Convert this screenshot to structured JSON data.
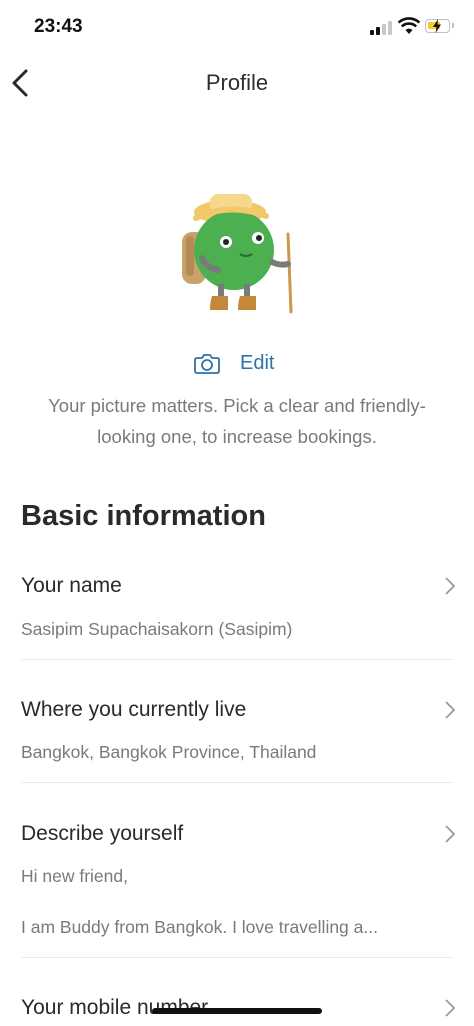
{
  "status_bar": {
    "time": "23:43"
  },
  "nav": {
    "title": "Profile",
    "back_icon": "chevron-left-icon"
  },
  "avatar": {
    "icon": "hiker-avatar",
    "edit_label": "Edit",
    "edit_icon": "camera-icon"
  },
  "hint": "Your picture matters. Pick a clear and friendly-looking one, to increase bookings.",
  "section": {
    "title": "Basic information"
  },
  "fields": [
    {
      "label": "Your name",
      "value": "Sasipim Supachaisakorn (Sasipim)"
    },
    {
      "label": "Where you currently live",
      "value": "Bangkok, Bangkok Province, Thailand"
    },
    {
      "label": "Describe yourself",
      "value_line1": "Hi new friend,",
      "value_line2": "I am Buddy from Bangkok. I love travelling a..."
    },
    {
      "label": "Your mobile number"
    }
  ],
  "colors": {
    "accent": "#2f72a6",
    "avatar_green": "#4caf50",
    "hat": "#f2c96a"
  }
}
